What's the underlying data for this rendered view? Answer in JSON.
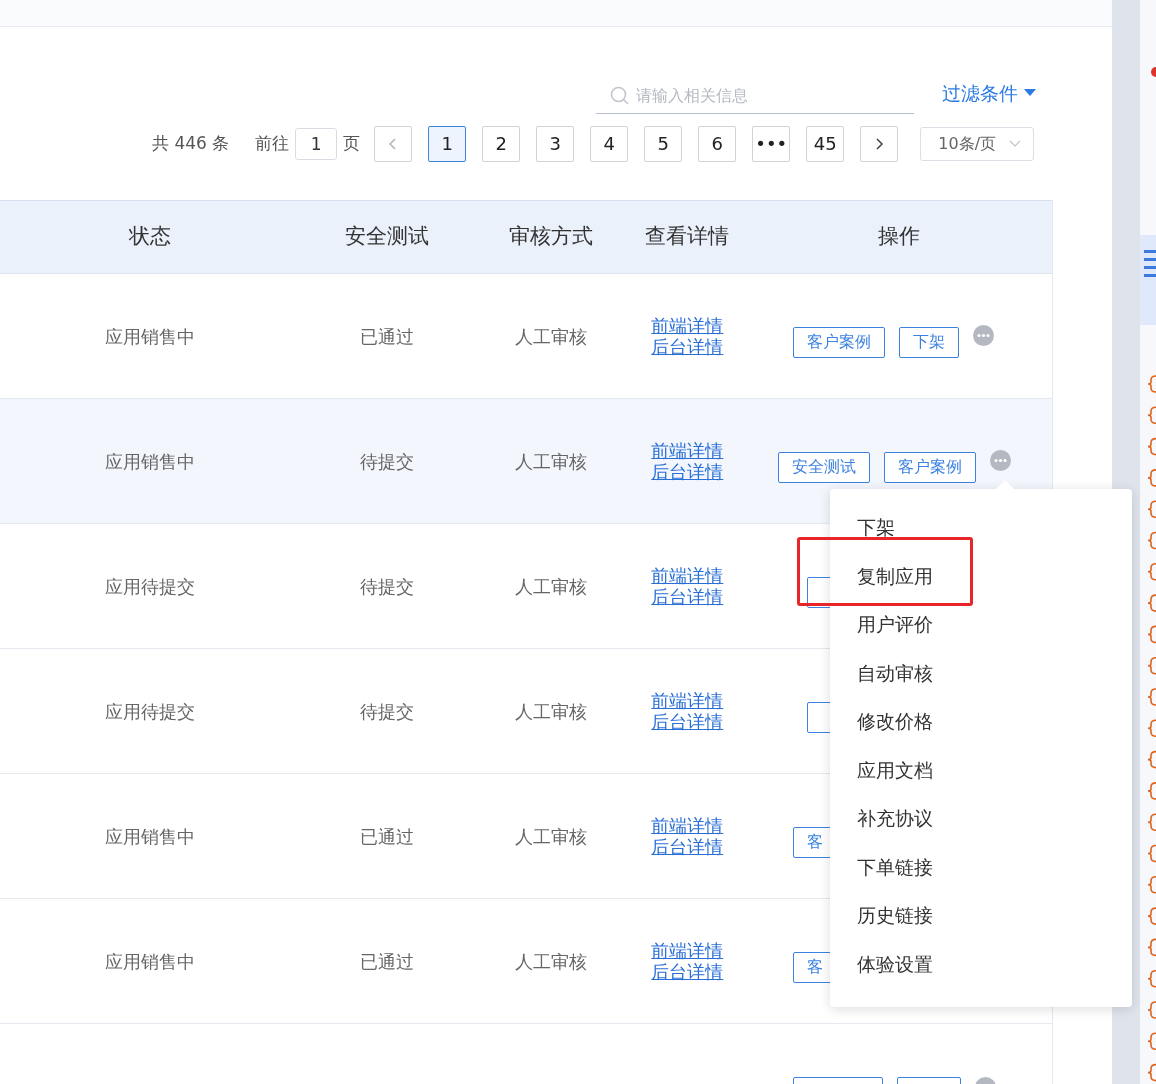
{
  "search": {
    "placeholder": "请输入相关信息"
  },
  "filter": {
    "label": "过滤条件"
  },
  "pagination": {
    "total": "共 446 条",
    "goto_label": "前往",
    "goto_value": "1",
    "page_unit": "页",
    "pages": [
      {
        "label": "1",
        "selected": true
      },
      {
        "label": "2",
        "selected": false
      },
      {
        "label": "3",
        "selected": false
      },
      {
        "label": "4",
        "selected": false
      },
      {
        "label": "5",
        "selected": false
      },
      {
        "label": "6",
        "selected": false
      },
      {
        "label": "•••",
        "selected": false
      },
      {
        "label": "45",
        "selected": false
      }
    ],
    "page_size": "10条/页"
  },
  "table": {
    "columns": [
      "状态",
      "安全测试",
      "审核方式",
      "查看详情",
      "操作"
    ],
    "rows": [
      {
        "status": "应用销售中",
        "safety": "已通过",
        "method": "人工审核",
        "links": [
          "前端详情",
          "后台详情"
        ],
        "hovered": false,
        "buttons": [
          {
            "label": "客户案例"
          },
          {
            "label": "下架"
          }
        ]
      },
      {
        "status": "应用销售中",
        "safety": "待提交",
        "method": "人工审核",
        "links": [
          "前端详情",
          "后台详情"
        ],
        "hovered": true,
        "buttons": [
          {
            "label": "安全测试"
          },
          {
            "label": "客户案例"
          }
        ]
      },
      {
        "status": "应用待提交",
        "safety": "待提交",
        "method": "人工审核",
        "links": [
          "前端详情",
          "后台详情"
        ],
        "hovered": false,
        "buttons": [
          {
            "kind": "covered"
          }
        ]
      },
      {
        "status": "应用待提交",
        "safety": "待提交",
        "method": "人工审核",
        "links": [
          "前端详情",
          "后台详情"
        ],
        "hovered": false,
        "buttons": [
          {
            "kind": "covered"
          }
        ]
      },
      {
        "status": "应用销售中",
        "safety": "已通过",
        "method": "人工审核",
        "links": [
          "前端详情",
          "后台详情"
        ],
        "hovered": false,
        "buttons": [
          {
            "label": "客"
          }
        ]
      },
      {
        "status": "应用销售中",
        "safety": "已通过",
        "method": "人工审核",
        "links": [
          "前端详情",
          "后台详情"
        ],
        "hovered": false,
        "buttons": [
          {
            "label": "客"
          }
        ]
      },
      {
        "hovered": false,
        "buttons": [
          {
            "kind": "covered"
          },
          {
            "kind": "covered"
          }
        ]
      }
    ]
  },
  "menu": {
    "items": [
      {
        "label": "下架",
        "highlighted": false
      },
      {
        "label": "复制应用",
        "highlighted": true
      },
      {
        "label": "用户评价",
        "highlighted": false
      },
      {
        "label": "自动审核",
        "highlighted": false
      },
      {
        "label": "修改价格",
        "highlighted": false
      },
      {
        "label": "应用文档",
        "highlighted": false
      },
      {
        "label": "补充协议",
        "highlighted": false
      },
      {
        "label": "下单链接",
        "highlighted": false
      },
      {
        "label": "历史链接",
        "highlighted": false
      },
      {
        "label": "体验设置",
        "highlighted": false
      }
    ]
  }
}
